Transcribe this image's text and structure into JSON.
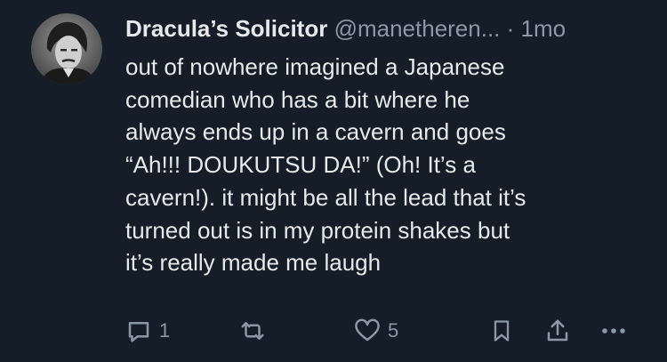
{
  "tweet": {
    "author": {
      "display_name": "Dracula’s Solicitor",
      "handle": "@manetheren...",
      "separator": "·",
      "time_ago": "1mo",
      "avatar_icon": "profile-photo"
    },
    "text": "out of nowhere imagined a Japanese\ncomedian who has a bit where he\nalways ends up in a cavern and goes\n“Ah!!! DOUKUTSU DA!” (Oh! It’s a\ncavern!). it might be all the lead that it’s\nturned out is in my protein shakes but\nit’s really made me laugh"
  },
  "actions": {
    "reply": {
      "icon": "reply-icon",
      "count": "1"
    },
    "retweet": {
      "icon": "retweet-icon"
    },
    "like": {
      "icon": "heart-icon",
      "count": "5"
    },
    "bookmark": {
      "icon": "bookmark-icon"
    },
    "share": {
      "icon": "share-icon"
    },
    "more": {
      "icon": "more-icon"
    }
  },
  "colors": {
    "background": "#151d28",
    "primary_text": "#e7e9ea",
    "secondary_text": "#8b98a5"
  }
}
